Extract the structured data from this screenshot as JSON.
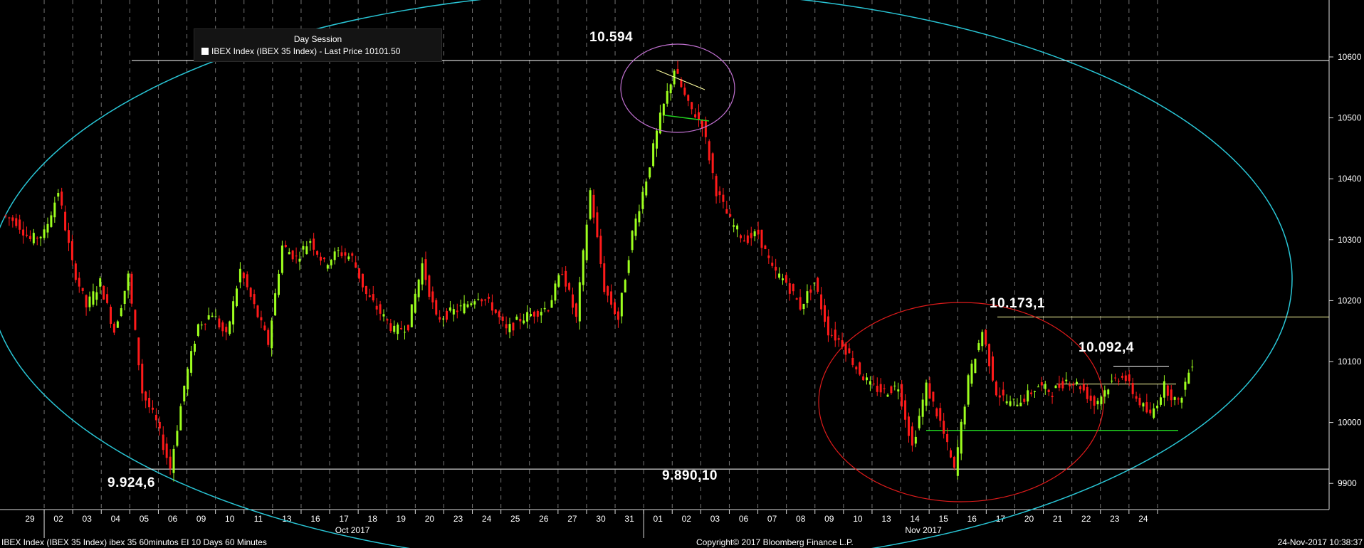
{
  "legend": {
    "session": "Day Session",
    "series": "IBEX Index (IBEX 35 Index) - Last Price 10101.50"
  },
  "annotations": {
    "peak": "10.594",
    "left_low": "9.924,6",
    "low": "9.890,10",
    "recent_high": "10.173,1",
    "current": "10.092,4"
  },
  "footer": {
    "left": "IBEX Index (IBEX 35 Index) ibex 35 60minutos EI 10 Days 60 Minutes",
    "center": "Copyright© 2017 Bloomberg Finance L.P.",
    "right": "24-Nov-2017 10:38:37"
  },
  "colors": {
    "up": "#9dff1e",
    "down": "#ff1a1a",
    "ellipse": "#29c6d6",
    "circle_top": "#c070d0",
    "circle_bottom": "#e01b1b",
    "trend_green": "#21d21f"
  },
  "chart_data": {
    "type": "candlestick",
    "title": "IBEX Index (IBEX 35 Index) - Last Price 10101.50",
    "y_axis": {
      "side": "right",
      "ticks": [
        9900,
        10000,
        10100,
        10200,
        10300,
        10400,
        10500,
        10600
      ],
      "ylim": [
        9850,
        10650
      ]
    },
    "x_axis": {
      "days": [
        "29",
        "02",
        "03",
        "04",
        "05",
        "06",
        "09",
        "10",
        "11",
        "13",
        "16",
        "17",
        "18",
        "19",
        "20",
        "23",
        "24",
        "25",
        "26",
        "27",
        "30",
        "31",
        "01",
        "02",
        "03",
        "06",
        "07",
        "08",
        "09",
        "10",
        "13",
        "14",
        "15",
        "16",
        "17",
        "20",
        "21",
        "22",
        "23",
        "24"
      ],
      "month_labels": [
        {
          "label": "Oct 2017",
          "day": "17"
        },
        {
          "label": "Nov 2017",
          "day": "14"
        }
      ]
    },
    "closes": [
      10330,
      10300,
      10310,
      10380,
      10260,
      10190,
      10230,
      10150,
      10240,
      10050,
      10000,
      9925,
      10060,
      10160,
      10180,
      10140,
      10250,
      10190,
      10130,
      10290,
      10270,
      10300,
      10260,
      10280,
      10270,
      10210,
      10180,
      10150,
      10160,
      10260,
      10170,
      10180,
      10190,
      10210,
      10190,
      10150,
      10170,
      10180,
      10190,
      10250,
      10170,
      10380,
      10220,
      10170,
      10310,
      10400,
      10500,
      10580,
      10520,
      10490,
      10380,
      10330,
      10300,
      10310,
      10250,
      10230,
      10190,
      10230,
      10150,
      10130,
      10090,
      10060,
      10050,
      10060,
      9960,
      10060,
      10000,
      9920,
      10070,
      10150,
      10050,
      10030,
      10040,
      10060,
      10050,
      10070,
      10060,
      10030,
      10060,
      10080,
      10040,
      10010,
      10060,
      10030,
      10100
    ],
    "levels": {
      "resistance_high": 10594,
      "support_low": 9924.6,
      "recent_high": 10173.1,
      "upper_range": 10092.4,
      "range_mid": 10063,
      "range_support": 9987
    }
  }
}
